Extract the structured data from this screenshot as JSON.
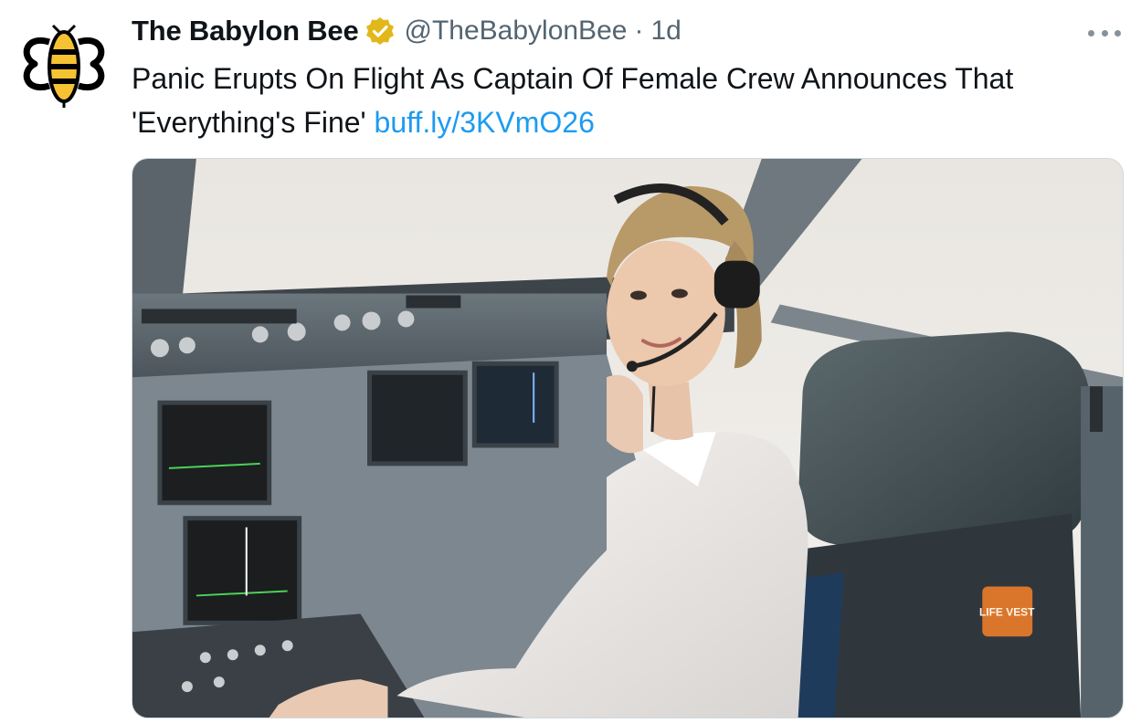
{
  "tweet": {
    "display_name": "The Babylon Bee",
    "handle": "@TheBabylonBee",
    "separator": "·",
    "time": "1d",
    "text": "Panic Erupts On Flight As Captain Of Female Crew Announces That 'Everything's Fine'",
    "link": "buff.ly/3KVmO26",
    "verified": true,
    "more_icon": "more-dots-icon"
  },
  "media": {
    "type": "photo",
    "sticker_label": "LIFE VEST"
  },
  "colors": {
    "name": "#0f1419",
    "secondary": "#536471",
    "link": "#1d9bf0",
    "verified_gold": "#e2b719",
    "bee_yellow": "#f6c234"
  }
}
